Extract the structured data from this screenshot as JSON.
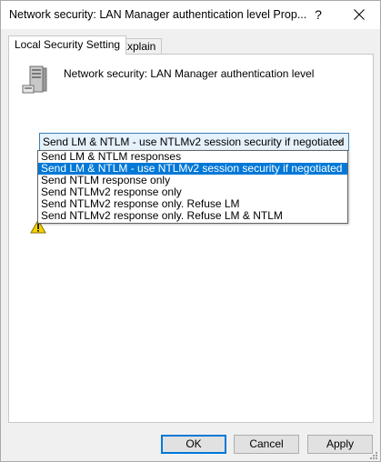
{
  "window": {
    "title": "Network security: LAN Manager authentication level Prop...",
    "help_label": "?"
  },
  "tabs": [
    {
      "label": "Local Security Setting",
      "active": true
    },
    {
      "label": "Explain",
      "active": false
    }
  ],
  "policy": {
    "title": "Network security: LAN Manager authentication level",
    "icon": "server-icon"
  },
  "combo": {
    "selected": "Send LM & NTLM - use NTLMv2 session security if negotiated"
  },
  "dropdown": {
    "options": [
      "Send LM & NTLM responses",
      "Send LM & NTLM - use NTLMv2 session security if negotiated",
      "Send NTLM response only",
      "Send NTLMv2 response only",
      "Send NTLMv2 response only. Refuse LM",
      "Send NTLMv2 response only. Refuse LM & NTLM"
    ],
    "highlighted_index": 1
  },
  "buttons": {
    "ok": "OK",
    "cancel": "Cancel",
    "apply": "Apply"
  },
  "colors": {
    "selection": "#0078d7",
    "combo_border": "#3c7fb1",
    "combo_fill": "#e5f1fb"
  }
}
